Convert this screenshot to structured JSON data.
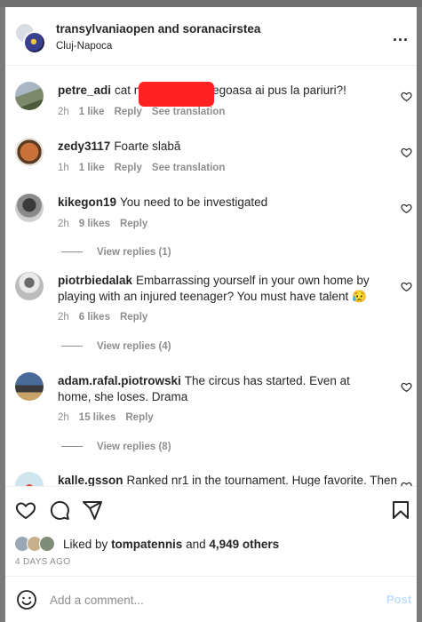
{
  "header": {
    "users": "transylvaniaopen and soranacirstea",
    "location": "Cluj-Napoca",
    "more_label": "..."
  },
  "comments": [
    {
      "user": "petre_adi",
      "text_before": "cat n",
      "text_after": "jegoasa ai pus la pariuri?!",
      "time": "2h",
      "likes": "1 like",
      "reply": "Reply",
      "translation": "See translation"
    },
    {
      "user": "zedy3117",
      "text": "Foarte slabă",
      "time": "1h",
      "likes": "1 like",
      "reply": "Reply",
      "translation": "See translation"
    },
    {
      "user": "kikegon19",
      "text": "You need to be investigated",
      "time": "2h",
      "likes": "9 likes",
      "reply": "Reply",
      "view_replies": "View replies (1)"
    },
    {
      "user": "piotrbiedalak",
      "text": "Embarrassing yourself in your own home by playing with an injured teenager? You must have talent 😥",
      "time": "2h",
      "likes": "6 likes",
      "reply": "Reply",
      "view_replies": "View replies (4)"
    },
    {
      "user": "adam.rafal.piotrowski",
      "text": "The circus has started. Even at home, she loses. Drama",
      "time": "2h",
      "likes": "15 likes",
      "reply": "Reply",
      "view_replies": "View replies (8)"
    },
    {
      "user": "kalle.gsson",
      "text": "Ranked nr1 in the tournament. Huge favorite. Then"
    }
  ],
  "liked_by": {
    "prefix": "Liked by",
    "user": "tompatennis",
    "and": "and",
    "others": "4,949 others"
  },
  "time_ago": "4 DAYS AGO",
  "add_comment": {
    "placeholder": "Add a comment...",
    "post_label": "Post"
  },
  "colors": {
    "text": "#262626",
    "secondary": "#8e8e8e",
    "post_disabled": "#c0dffd",
    "redaction": "#ff2222"
  },
  "icons": [
    "more-icon",
    "heart-icon",
    "comment-icon",
    "share-icon",
    "bookmark-icon",
    "emoji-icon"
  ]
}
